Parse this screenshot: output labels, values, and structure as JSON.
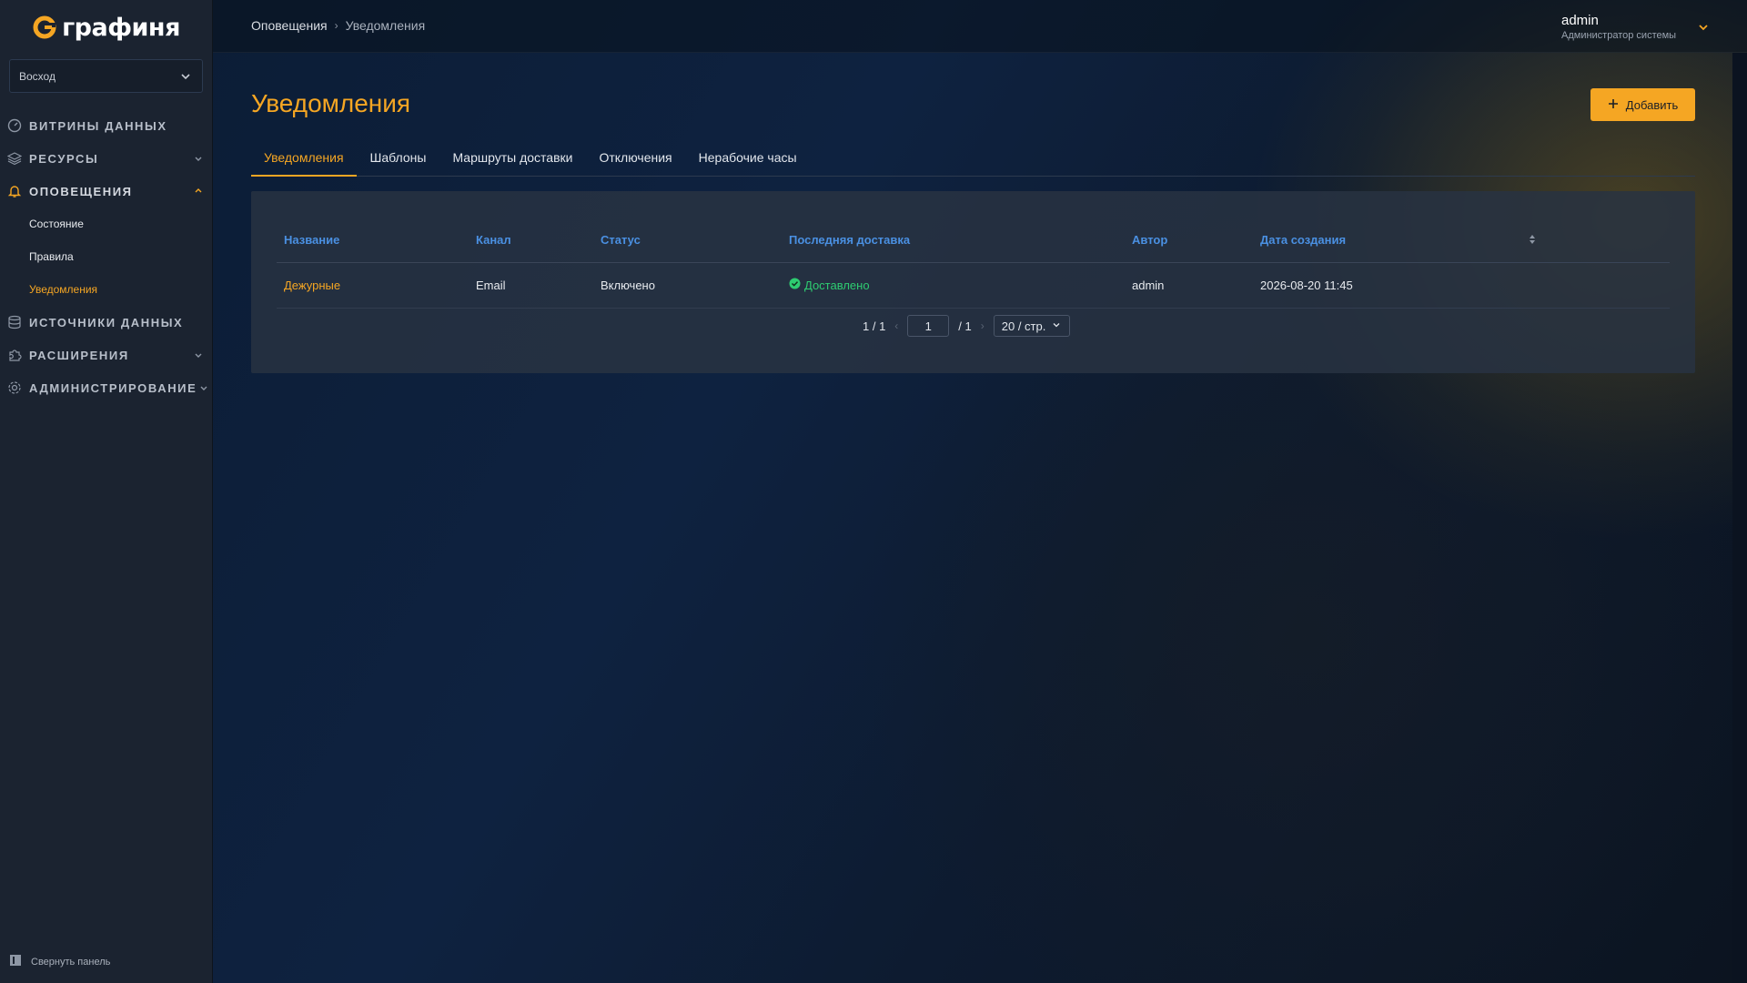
{
  "app": {
    "logo_text": "графиня",
    "org_selector": "Восход",
    "collapse_label": "Свернуть панель"
  },
  "sidebar": {
    "items": [
      {
        "label": "Витрины данных",
        "icon": "dashboard-icon",
        "expandable": false
      },
      {
        "label": "Ресурсы",
        "icon": "layers-icon",
        "expandable": true
      },
      {
        "label": "Оповещения",
        "icon": "bell-icon",
        "expandable": true,
        "expanded": true
      },
      {
        "label": "Источники данных",
        "icon": "database-icon",
        "expandable": false
      },
      {
        "label": "Расширения",
        "icon": "puzzle-icon",
        "expandable": true
      },
      {
        "label": "Администрирование",
        "icon": "gear-icon",
        "expandable": true
      }
    ],
    "alerting_sub": [
      "Состояние",
      "Правила",
      "Уведомления"
    ]
  },
  "header": {
    "breadcrumb": [
      "Оповещения",
      "Уведомления"
    ],
    "user_name": "admin",
    "user_role": "Администратор системы"
  },
  "page": {
    "title": "Уведомления",
    "add_button": "Добавить"
  },
  "tabs": [
    "Уведомления",
    "Шаблоны",
    "Маршруты доставки",
    "Отключения",
    "Нерабочие часы"
  ],
  "table": {
    "columns": [
      "Название",
      "Канал",
      "Статус",
      "Последняя доставка",
      "Автор",
      "Дата создания"
    ],
    "rows": [
      {
        "name": "Дежурные",
        "channel": "Email",
        "status": "Включено",
        "last_delivery": "Доставлено",
        "author": "admin",
        "created": "2026-08-20 11:45"
      }
    ]
  },
  "pagination": {
    "summary": "1 / 1",
    "current_page": "1",
    "total_sep": "/  1",
    "page_size": "20 / стр."
  },
  "colors": {
    "accent": "#f5a623",
    "link_header": "#4a90e2",
    "success": "#2ecc71"
  }
}
